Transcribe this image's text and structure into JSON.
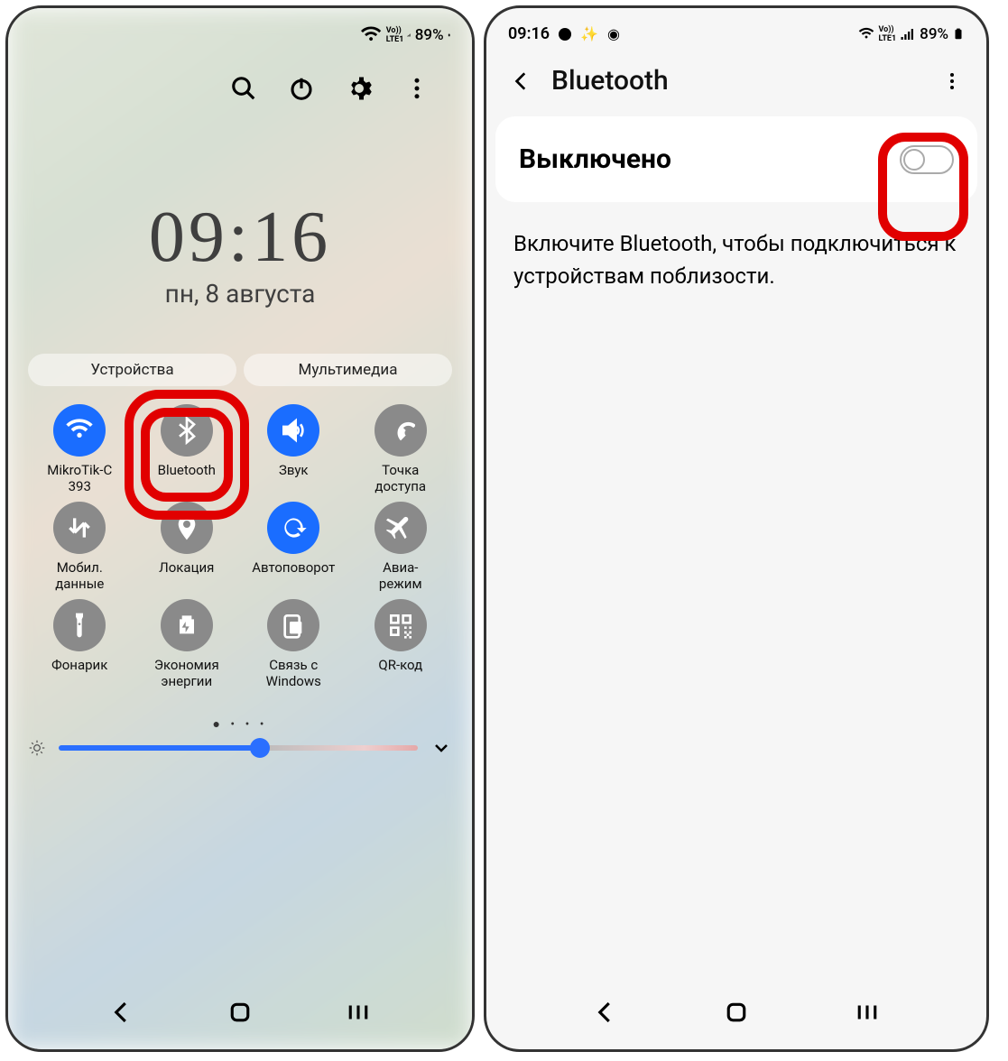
{
  "phone1": {
    "status": {
      "battery": "89%"
    },
    "clock": {
      "time": "09:16",
      "date": "пн, 8 августа"
    },
    "tabs": [
      "Устройства",
      "Мультимедиа"
    ],
    "tiles": [
      {
        "icon": "wifi",
        "label": "MikroTik-C\n393",
        "active": true
      },
      {
        "icon": "bluetooth",
        "label": "Bluetooth",
        "active": false,
        "highlight": true
      },
      {
        "icon": "sound",
        "label": "Звук",
        "active": true
      },
      {
        "icon": "hotspot",
        "label": "Точка\nдоступа",
        "active": false
      },
      {
        "icon": "data",
        "label": "Мобил.\nданные",
        "active": false
      },
      {
        "icon": "location",
        "label": "Локация",
        "active": false
      },
      {
        "icon": "rotate",
        "label": "Автоповорот",
        "active": true
      },
      {
        "icon": "airplane",
        "label": "Авиа-\nрежим",
        "active": false
      },
      {
        "icon": "flashlight",
        "label": "Фонарик",
        "active": false
      },
      {
        "icon": "battery",
        "label": "Экономия\nэнергии",
        "active": false
      },
      {
        "icon": "windows",
        "label": "Связь с\nWindows",
        "active": false
      },
      {
        "icon": "qr",
        "label": "QR-код",
        "active": false
      }
    ]
  },
  "phone2": {
    "status": {
      "time": "09:16",
      "battery": "89%"
    },
    "title": "Bluetooth",
    "toggle_label": "Выключено",
    "message": "Включите Bluetooth, чтобы подключиться к устройствам поблизости."
  }
}
